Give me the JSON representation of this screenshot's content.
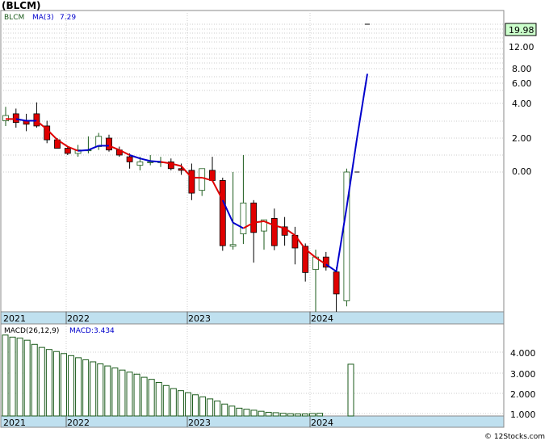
{
  "ticker_title": "(BLCM)",
  "price_legend": {
    "symbol": "BLCM",
    "ma_label": "MA(3)",
    "ma_value": "7.29"
  },
  "macd_legend": {
    "label": "MACD(26,12,9)",
    "value_label": "MACD:3.434"
  },
  "last_price_label": "19.98",
  "copyright": "© 12Stocks.com",
  "colors": {
    "down_candle": "#e00000",
    "up_candle": "#1a5a1a",
    "ma_line_down": "#e00000",
    "ma_line_up": "#0000cc",
    "macd_bar": "#1a5a1a",
    "year_band": "#bfe0ef",
    "last_price_box": "#ccffcc"
  },
  "chart_data": [
    {
      "type": "candlestick",
      "title": "(BLCM)",
      "y_scale": "non-linear (log-like)",
      "y_ticks": [
        "19.98",
        "12.00",
        "8.00",
        "6.00",
        "4.00",
        "2.00",
        "0.00"
      ],
      "x_year_labels": [
        "2021",
        "2022",
        "2023",
        "2024"
      ],
      "grid": true,
      "series": [
        {
          "name": "BLCM",
          "ohlc": [
            {
              "o": 3.0,
              "h": 3.8,
              "l": 2.7,
              "c": 3.3
            },
            {
              "o": 3.4,
              "h": 3.7,
              "l": 2.6,
              "c": 2.9
            },
            {
              "o": 3.0,
              "h": 3.4,
              "l": 2.4,
              "c": 2.8
            },
            {
              "o": 3.4,
              "h": 4.1,
              "l": 2.6,
              "c": 2.7
            },
            {
              "o": 2.7,
              "h": 3.0,
              "l": 1.7,
              "c": 1.9
            },
            {
              "o": 1.9,
              "h": 2.0,
              "l": 1.4,
              "c": 1.4
            },
            {
              "o": 1.4,
              "h": 1.5,
              "l": 1.0,
              "c": 1.1
            },
            {
              "o": 1.1,
              "h": 1.6,
              "l": 0.9,
              "c": 1.3
            },
            {
              "o": 1.3,
              "h": 2.1,
              "l": 1.1,
              "c": 1.3
            },
            {
              "o": 1.5,
              "h": 2.3,
              "l": 1.3,
              "c": 2.1
            },
            {
              "o": 2.0,
              "h": 2.2,
              "l": 1.2,
              "c": 1.3
            },
            {
              "o": 1.3,
              "h": 1.5,
              "l": 0.9,
              "c": 1.0
            },
            {
              "o": 0.9,
              "h": 1.1,
              "l": 0.2,
              "c": 0.6
            },
            {
              "o": 0.4,
              "h": 0.9,
              "l": 0.1,
              "c": 0.6
            },
            {
              "o": 0.6,
              "h": 1.0,
              "l": 0.4,
              "c": 0.6
            },
            {
              "o": 0.6,
              "h": 0.9,
              "l": 0.3,
              "c": 0.6
            },
            {
              "o": 0.6,
              "h": 0.8,
              "l": 0.1,
              "c": 0.2
            },
            {
              "o": 0.2,
              "h": 0.5,
              "l": -0.2,
              "c": 0.1
            },
            {
              "o": 0.1,
              "h": 0.5,
              "l": -2.0,
              "c": -1.5
            },
            {
              "o": -1.3,
              "h": 0.2,
              "l": -1.7,
              "c": 0.2
            },
            {
              "o": 0.1,
              "h": 0.9,
              "l": -0.2,
              "c": -0.6
            },
            {
              "o": -0.6,
              "h": -0.4,
              "l": -6.5,
              "c": -5.6
            },
            {
              "o": -5.7,
              "h": 0.0,
              "l": -6.3,
              "c": -5.4
            },
            {
              "o": -4.4,
              "h": 1.0,
              "l": -5.3,
              "c": -2.2
            },
            {
              "o": -2.2,
              "h": -2.0,
              "l": -8.6,
              "c": -4.3
            },
            {
              "o": -4.2,
              "h": -3.9,
              "l": -6.3,
              "c": -3.4
            },
            {
              "o": -3.3,
              "h": -2.6,
              "l": -6.4,
              "c": -5.6
            },
            {
              "o": -3.9,
              "h": -3.2,
              "l": -5.6,
              "c": -4.5
            },
            {
              "o": -4.5,
              "h": -3.9,
              "l": -8.9,
              "c": -6.0
            },
            {
              "o": -5.7,
              "h": -5.2,
              "l": -14.0,
              "c": -10.7
            },
            {
              "o": -9.8,
              "h": -6.3,
              "l": -25.0,
              "c": -7.6
            },
            {
              "o": -7.6,
              "h": -6.7,
              "l": -10.0,
              "c": -9.4
            },
            {
              "o": -10.5,
              "h": -9.4,
              "l": -25.0,
              "c": -18.5
            },
            {
              "o": -21.0,
              "h": 0.2,
              "l": -23.0,
              "c": 0.0
            },
            {
              "o": 0.0,
              "h": 0.0,
              "l": 0.0,
              "c": 0.0
            },
            {
              "o": 19.98,
              "h": 19.98,
              "l": 19.98,
              "c": 19.98
            }
          ]
        },
        {
          "name": "MA(3)",
          "values": [
            3.1,
            3.1,
            3.0,
            3.0,
            2.5,
            1.9,
            1.5,
            1.25,
            1.3,
            1.55,
            1.55,
            1.3,
            1.0,
            0.8,
            0.65,
            0.6,
            0.5,
            0.35,
            -0.4,
            -0.4,
            -0.6,
            -2.0,
            -3.6,
            -4.0,
            -3.6,
            -3.5,
            -3.8,
            -4.0,
            -4.5,
            -6.2,
            -7.7,
            -8.9,
            -10.3,
            -2.5,
            2.0,
            7.29
          ],
          "rising_from_index": [
            2,
            3,
            8,
            9,
            10,
            13,
            14,
            15,
            22,
            23,
            32,
            33,
            34,
            35
          ]
        }
      ]
    },
    {
      "type": "bar",
      "title": "MACD(26,12,9)",
      "y_ticks": [
        "4.000",
        "3.000",
        "2.000",
        "1.000"
      ],
      "x_year_labels": [
        "2021",
        "2022",
        "2023",
        "2024"
      ],
      "series": [
        {
          "name": "MACD",
          "values": [
            4.85,
            4.75,
            4.7,
            4.6,
            4.4,
            4.25,
            4.15,
            4.05,
            3.95,
            3.85,
            3.75,
            3.65,
            3.55,
            3.45,
            3.35,
            3.25,
            3.15,
            3.05,
            2.95,
            2.8,
            2.7,
            2.55,
            2.4,
            2.25,
            2.15,
            2.05,
            1.95,
            1.85,
            1.75,
            1.65,
            1.5,
            1.4,
            1.3,
            1.25,
            1.2,
            1.15,
            1.1,
            1.08,
            1.05,
            1.03,
            1.02,
            1.02,
            1.04,
            1.05,
            3.434
          ]
        }
      ]
    }
  ]
}
